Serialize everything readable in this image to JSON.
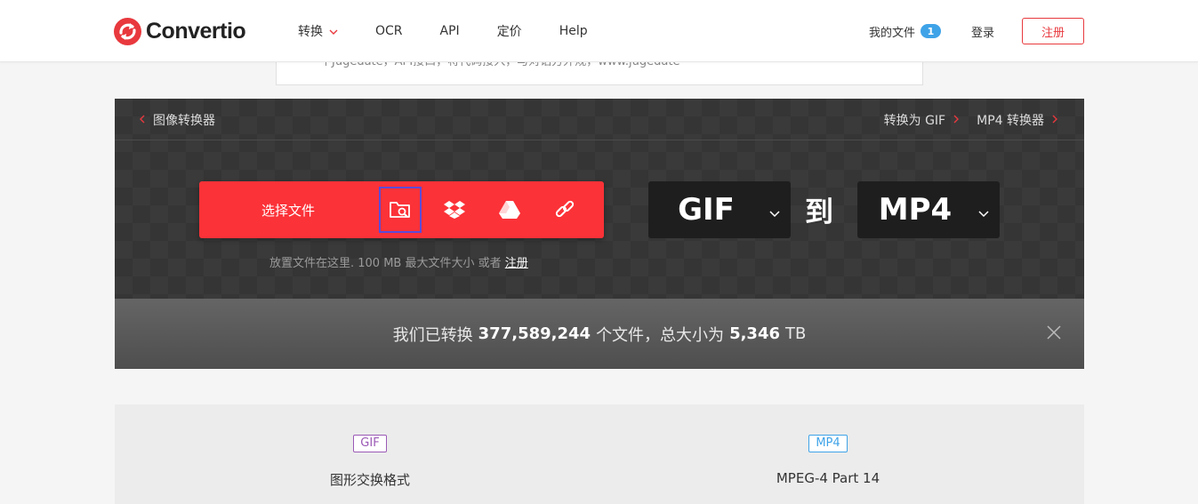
{
  "header": {
    "logo_text": "Convertio",
    "nav": [
      {
        "label": "转换"
      },
      {
        "label": "OCR"
      },
      {
        "label": "API"
      },
      {
        "label": "定价"
      },
      {
        "label": "Help"
      }
    ],
    "my_files_label": "我的文件",
    "my_files_count": "1",
    "login_label": "登录",
    "register_label": "注册"
  },
  "ad": {
    "text": "一个Jugedate，API接口，将代码接入，与对话方外规，www.jugedate"
  },
  "panel": {
    "crumb_left": "图像转换器",
    "crumb_right": [
      "转换为 GIF",
      "MP4 转换器"
    ],
    "select_label": "选择文件",
    "source_icons": [
      "folder-search-icon",
      "dropbox-icon",
      "google-drive-icon",
      "link-icon"
    ],
    "drop_hint": "放置文件在这里. 100 MB 最大文件大小 或者",
    "drop_hint_link": "注册",
    "from_format": "GIF",
    "to_word": "到",
    "to_format": "MP4"
  },
  "stats": {
    "prefix": "我们已转换",
    "files_count": "377,589,244",
    "middle": "个文件，总大小为",
    "size": "5,346",
    "unit": "TB"
  },
  "formats": [
    {
      "tag": "GIF",
      "name": "图形交换格式",
      "color": "#9b59b6"
    },
    {
      "tag": "MP4",
      "name": "MPEG-4 Part 14",
      "color": "#3fa3e8"
    }
  ],
  "colors": {
    "brand_red": "#fb3238",
    "accent_blue": "#3fa3e8"
  }
}
